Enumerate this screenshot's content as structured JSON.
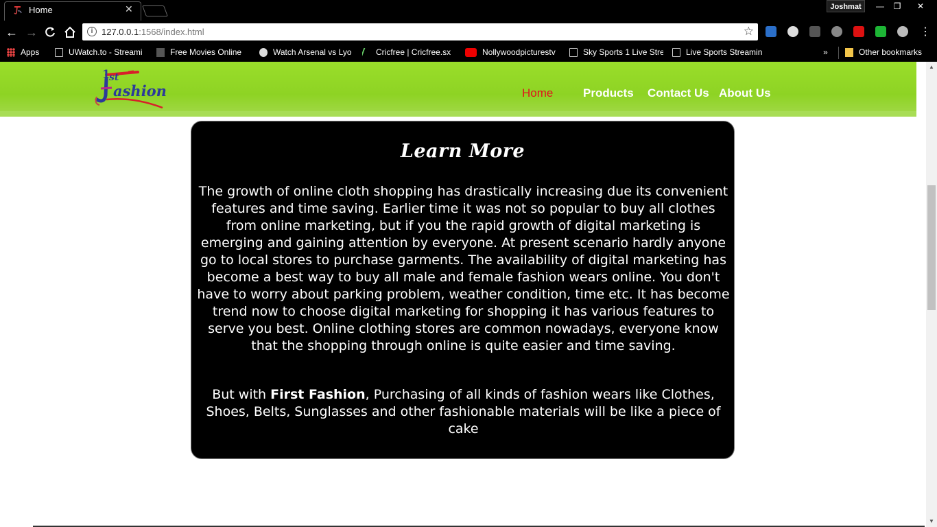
{
  "browser": {
    "tab_title": "Home",
    "profile_name": "Joshmat",
    "url_host": "127.0.0.1",
    "url_rest": ":1568/index.html",
    "bookmarks": [
      "Apps",
      "UWatch.to - Streami",
      "Free Movies Online",
      "Watch Arsenal vs Lyo",
      "Cricfree | Cricfree.sx",
      "Nollywoodpicturestv",
      "Sky Sports 1 Live Stre",
      "Live Sports Streamin"
    ],
    "overflow_chevron": "»",
    "other_bookmarks": "Other bookmarks",
    "window_controls": [
      "—",
      "❐",
      "✕"
    ]
  },
  "site": {
    "nav": {
      "home": "Home",
      "products": "Products",
      "contact": "Contact Us",
      "about": "About Us"
    },
    "colors": {
      "header_green": "#8ed324",
      "active_nav": "#e0151d",
      "card_bg": "#000000"
    },
    "learn_more": {
      "title": "Learn More",
      "paragraph1": "The growth of online cloth shopping has drastically increasing due its convenient features and time saving. Earlier time it was not so popular to buy all clothes from online marketing, but if you the rapid growth of digital marketing is emerging and gaining attention by everyone. At present scenario hardly anyone go to local stores to purchase garments. The availability of digital marketing has become a best way to buy all male and female fashion wears online. You don't have to worry about parking problem, weather condition, time etc. It has become trend now to choose digital marketing for shopping it has various features to serve you best. Online clothing stores are common nowadays, everyone know that the shopping through online is quite easier and time saving.",
      "p2_before": "But with ",
      "p2_brand": "First Fashion",
      "p2_after": ", Purchasing of all kinds of fashion wears like Clothes, Shoes, Belts, Sunglasses and other fashionable materials will be like a piece of cake"
    }
  }
}
